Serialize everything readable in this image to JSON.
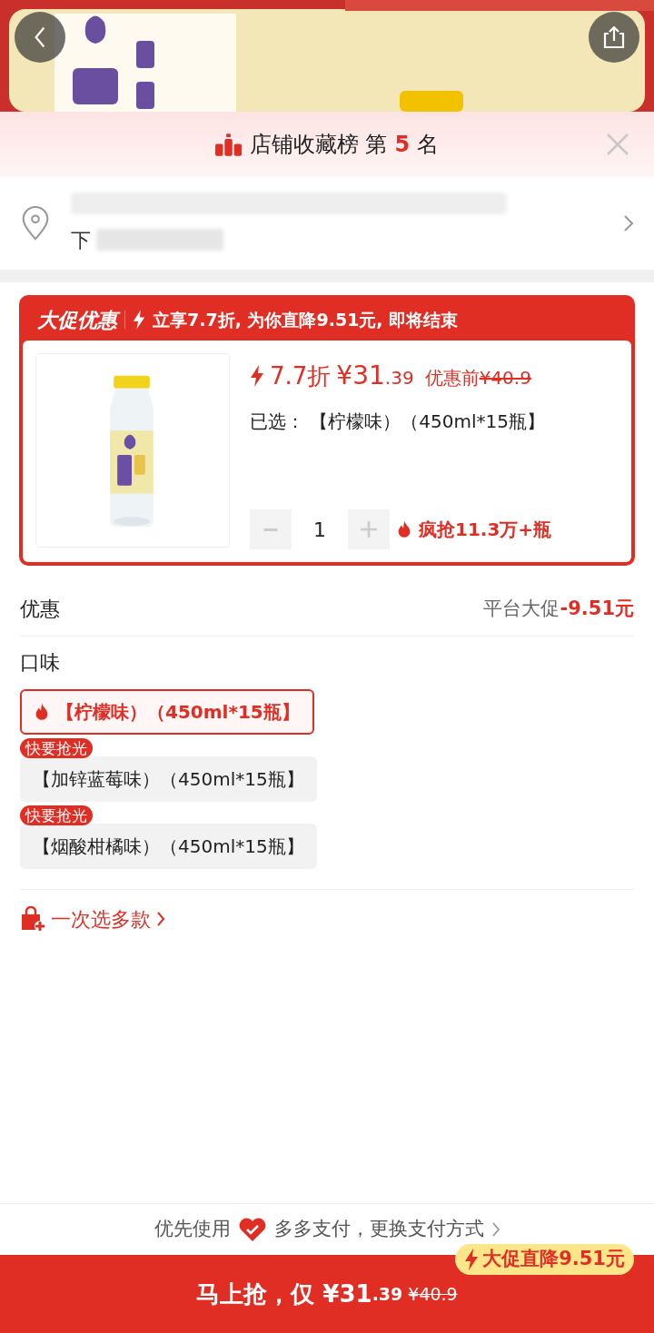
{
  "ranking_banner": {
    "text": "店铺收藏榜 第",
    "rank": "5",
    "suffix": "名"
  },
  "address": {
    "visible_text": "下"
  },
  "promo": {
    "tag": "大促优惠",
    "headline": "立享7.7折, 为你直降9.51元, 即将结束",
    "discount": "7.7折",
    "price_main": "¥31",
    "price_decimal": ".39",
    "original_label": "优惠前",
    "original_price": "¥40.9",
    "selected_label": "已选：",
    "selected_value": "【柠檬味）（450ml*15瓶】",
    "quantity": "1",
    "sold": "疯抢11.3万+瓶"
  },
  "discount_row": {
    "label": "优惠",
    "detail": "平台大促",
    "amount": "-9.51元"
  },
  "flavor_section": {
    "title": "口味",
    "options": [
      {
        "label": "【柠檬味）（450ml*15瓶】",
        "selected": true
      },
      {
        "label": "【加锌蓝莓味）（450ml*15瓶】",
        "selected": false,
        "badge": "快要抢光"
      },
      {
        "label": "【烟酸柑橘味）（450ml*15瓶】",
        "selected": false,
        "badge": "快要抢光"
      }
    ]
  },
  "multi_select": {
    "label": "一次选多款"
  },
  "payment": {
    "prefix": "优先使用",
    "text": "多多支付，更换支付方式"
  },
  "buy_button": {
    "label": "马上抢，仅",
    "price_main": "¥31",
    "price_decimal": ".39",
    "original_price": "¥40.9",
    "badge": "大促直降9.51元"
  }
}
